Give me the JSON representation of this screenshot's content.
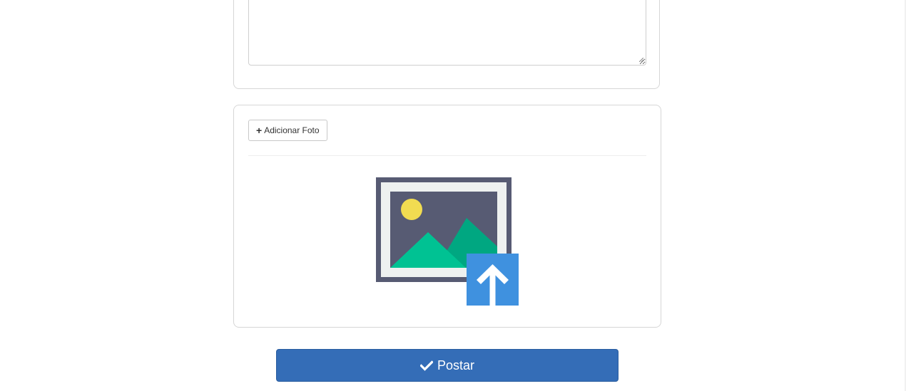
{
  "post_form": {
    "description": {
      "value": "",
      "placeholder": ""
    },
    "photo_panel": {
      "add_photo_label": "Adicionar Foto",
      "add_photo_icon": "plus-icon",
      "placeholder_icon": "image-upload-icon"
    },
    "submit": {
      "label": "Postar",
      "icon": "check-icon",
      "color": "#346db7"
    }
  },
  "colors": {
    "frame": "#575b73",
    "mat": "#eef1f0",
    "sun": "#f1dc51",
    "mountain_front": "#00c293",
    "mountain_back": "#00a781",
    "upload_badge": "#3f91df"
  }
}
